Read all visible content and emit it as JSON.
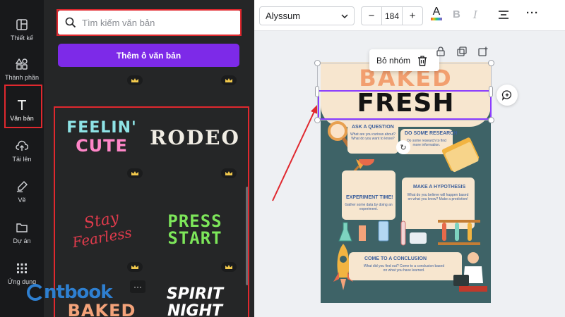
{
  "rail": {
    "items": [
      {
        "label": "Thiết kế",
        "icon": "layout-icon"
      },
      {
        "label": "Thành phần",
        "icon": "shapes-icon"
      },
      {
        "label": "Văn bản",
        "icon": "text-icon"
      },
      {
        "label": "Tải lên",
        "icon": "cloud-upload-icon"
      },
      {
        "label": "Vẽ",
        "icon": "pen-icon"
      },
      {
        "label": "Dự án",
        "icon": "folder-icon"
      },
      {
        "label": "Ứng dụng",
        "icon": "apps-icon"
      }
    ]
  },
  "panel": {
    "search_placeholder": "Tìm kiếm văn bản",
    "add_textbox": "Thêm ô văn bản",
    "more": "···",
    "presets": [
      {
        "line1": "FEELIN'",
        "line2": "CUTE"
      },
      {
        "line1": "RODEO"
      },
      {
        "line1": "Stay",
        "line2": "Fearless"
      },
      {
        "line1": "PRESS",
        "line2": "START"
      },
      {
        "line1": "BAKED"
      },
      {
        "line1": "SPIRIT",
        "line2": "NIGHT"
      }
    ]
  },
  "toolbar": {
    "font": "Alyssum",
    "font_size": "184",
    "decrease": "−",
    "increase": "+",
    "color_glyph": "A",
    "bold_glyph": "B",
    "italic_glyph": "I",
    "more": "···"
  },
  "canvas": {
    "tooltip_label": "Bỏ nhóm",
    "heading_top": "BAKED",
    "heading_main": "FRESH",
    "cards": [
      {
        "title": "ASK A QUESTION",
        "text": "What are you curious about? What do you want to know?"
      },
      {
        "title": "DO SOME RESEARCH",
        "text": "Do some research to find more information."
      },
      {
        "title": "EXPERIMENT TIME!",
        "text": "Gather some data by doing an experiment."
      },
      {
        "title": "MAKE A HYPOTHESIS",
        "text": "What do you believe will happen based on what you know? Make a prediction!"
      },
      {
        "title": "COME TO A CONCLUSION",
        "text": "What did you find out? Come to a conclusion based on what you have learned."
      }
    ]
  },
  "watermark": {
    "text": "ntbook"
  },
  "colors": {
    "accent": "#8b3dff",
    "button": "#7d2ae8",
    "highlight": "#e0282e",
    "page_bg": "#3e6367",
    "card_bg": "#f7e6cf"
  }
}
